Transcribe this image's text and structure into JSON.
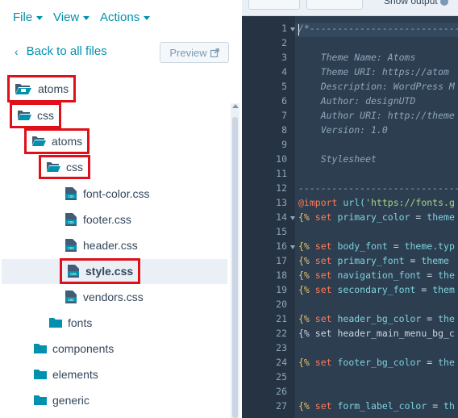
{
  "menubar": {
    "file": "File",
    "view": "View",
    "actions": "Actions"
  },
  "back_link": "Back to all files",
  "preview_button": "Preview",
  "tree": [
    {
      "label": "atoms",
      "type": "folder-root",
      "highlighted": true
    },
    {
      "label": "css",
      "type": "folder-open",
      "highlighted": true
    },
    {
      "label": "atoms",
      "type": "folder-open",
      "highlighted": true
    },
    {
      "label": "css",
      "type": "folder-open",
      "highlighted": true
    },
    {
      "label": "font-color.css",
      "type": "css-file",
      "highlighted": false
    },
    {
      "label": "footer.css",
      "type": "css-file",
      "highlighted": false
    },
    {
      "label": "header.css",
      "type": "css-file",
      "highlighted": false
    },
    {
      "label": "style.css",
      "type": "css-file",
      "highlighted": true,
      "selected": true
    },
    {
      "label": "vendors.css",
      "type": "css-file",
      "highlighted": false
    },
    {
      "label": "fonts",
      "type": "folder-closed",
      "highlighted": false
    },
    {
      "label": "components",
      "type": "folder-closed",
      "highlighted": false
    },
    {
      "label": "elements",
      "type": "folder-closed",
      "highlighted": false
    },
    {
      "label": "generic",
      "type": "folder-closed",
      "highlighted": false
    }
  ],
  "editor": {
    "show_output": "Show output",
    "line_numbers": [
      "1",
      "2",
      "3",
      "4",
      "5",
      "6",
      "7",
      "8",
      "9",
      "10",
      "11",
      "12",
      "13",
      "14",
      "15",
      "16",
      "17",
      "18",
      "19",
      "20",
      "21",
      "22",
      "23",
      "24",
      "25",
      "26",
      "27"
    ],
    "lines": [
      "/*---------------------------------",
      "",
      "    Theme Name: Atoms",
      "    Theme URI: https://atom",
      "    Description: WordPress M",
      "    Author: designUTD",
      "    Author URI: http://theme",
      "    Version: 1.0",
      "",
      "    Stylesheet",
      "",
      "----------------------------------",
      "@import url('https://fonts.g",
      "{% set primary_color = theme",
      "",
      "{% set body_font = theme.typ",
      "{% set primary_font = theme",
      "{% set navigation_font = the",
      "{% set secondary_font = them",
      "",
      "{% set header_bg_color = the",
      "{% set header_main_menu_bg_c",
      "",
      "{% set footer_bg_color = the",
      "",
      "",
      "{% set form_label_color = th"
    ]
  },
  "colors": {
    "accent": "#0091ae",
    "highlight_box": "#e0101a",
    "editor_bg": "#2d3e50"
  }
}
